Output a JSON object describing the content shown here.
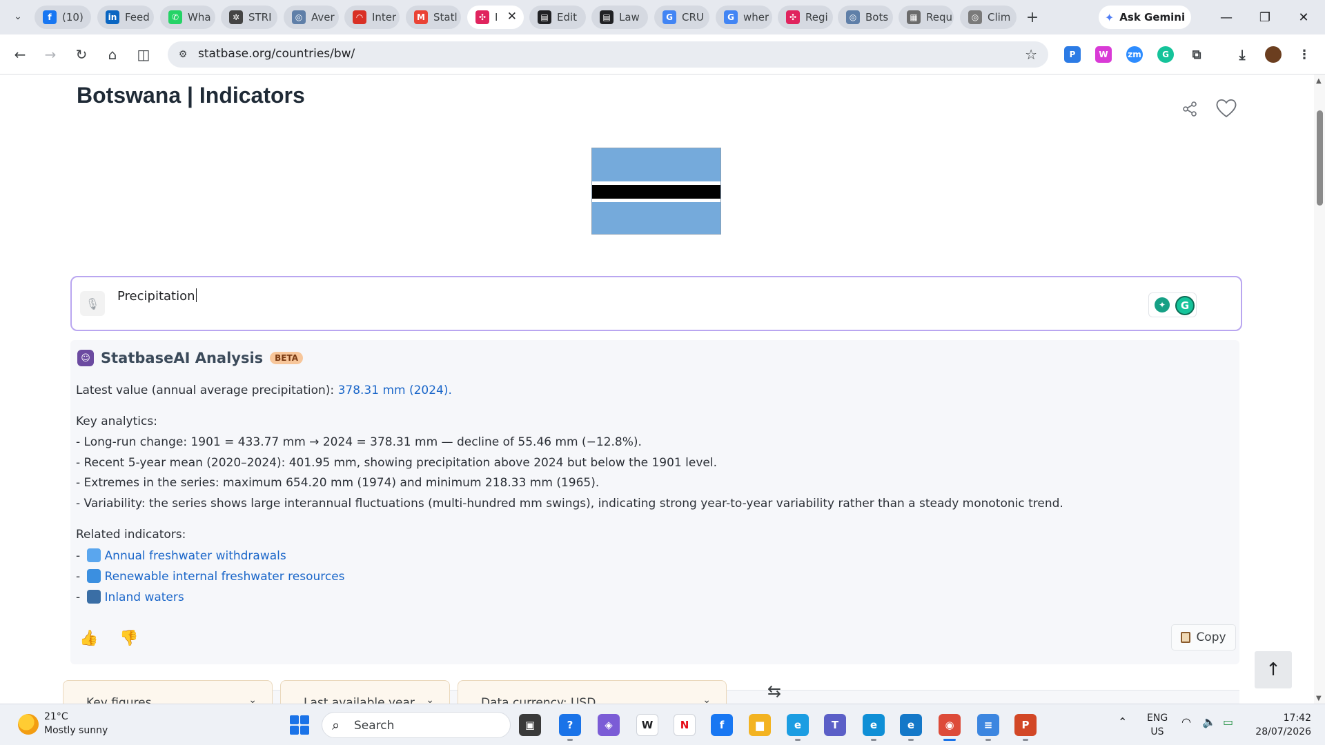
{
  "browser": {
    "tabs": [
      {
        "label": "(10)",
        "icon": "facebook-icon",
        "color": "#1877f2",
        "glyph": "f"
      },
      {
        "label": "Feed",
        "icon": "linkedin-icon",
        "color": "#0a66c2",
        "glyph": "in"
      },
      {
        "label": "Wha",
        "icon": "whatsapp-icon",
        "color": "#25d366",
        "glyph": "✆"
      },
      {
        "label": "STRI",
        "icon": "openai-icon",
        "color": "#444444",
        "glyph": "✲"
      },
      {
        "label": "Aver",
        "icon": "globe-icon",
        "color": "#5f7fa8",
        "glyph": "◎"
      },
      {
        "label": "Inter",
        "icon": "gauge-icon",
        "color": "#d93025",
        "glyph": "◠"
      },
      {
        "label": "Statl",
        "icon": "gmail-icon",
        "color": "#ea4335",
        "glyph": "M"
      },
      {
        "label": "I",
        "icon": "statbase-icon",
        "color": "#e0245e",
        "glyph": "✣",
        "active": true
      },
      {
        "label": "Edit",
        "icon": "terminal-icon",
        "color": "#202124",
        "glyph": "▤"
      },
      {
        "label": "Law",
        "icon": "terminal-icon",
        "color": "#202124",
        "glyph": "▤"
      },
      {
        "label": "CRU",
        "icon": "google-icon",
        "color": "#4285f4",
        "glyph": "G"
      },
      {
        "label": "wher",
        "icon": "google-icon",
        "color": "#4285f4",
        "glyph": "G"
      },
      {
        "label": "Regi",
        "icon": "statbase-icon",
        "color": "#e0245e",
        "glyph": "✣"
      },
      {
        "label": "Bots",
        "icon": "globe-icon",
        "color": "#5f7fa8",
        "glyph": "◎"
      },
      {
        "label": "Requ",
        "icon": "image-icon",
        "color": "#6b6b6b",
        "glyph": "▦"
      },
      {
        "label": "Clim",
        "icon": "globe-icon",
        "color": "#7a7a7a",
        "glyph": "◎"
      }
    ],
    "new_tab": "+",
    "gemini_label": "Ask Gemini",
    "url": "statbase.org/countries/bw/"
  },
  "page": {
    "title": "Botswana | Indicators",
    "flag_colors": {
      "blue": "#75aadb",
      "white": "#ffffff",
      "black": "#000000"
    },
    "search": {
      "value": "Precipitation"
    },
    "ai": {
      "title": "StatbaseAI Analysis",
      "badge": "BETA",
      "latest_prefix": "Latest value (annual average precipitation): ",
      "latest_value": "378.31 mm (2024).",
      "key_heading": "Key analytics:",
      "key_lines": [
        "- Long-run change: 1901 = 433.77 mm → 2024 = 378.31 mm — decline of 55.46 mm (−12.8%).",
        "- Recent 5-year mean (2020–2024): 401.95 mm, showing precipitation above 2024 but below the 1901 level.",
        "- Extremes in the series: maximum 654.20 mm (1974) and minimum 218.33 mm (1965).",
        "- Variability: the series shows large interannual fluctuations (multi-hundred mm swings), indicating strong year-to-year variability rather than a steady monotonic trend."
      ],
      "related_heading": "Related indicators:",
      "related": [
        {
          "label": "Annual freshwater withdrawals",
          "icon": "droplet-icon",
          "color": "#3b8fe0"
        },
        {
          "label": "Renewable internal freshwater resources",
          "icon": "wave-icon",
          "color": "#2f7fd0"
        },
        {
          "label": "Inland waters",
          "icon": "lake-icon",
          "color": "#3a6ea5"
        }
      ],
      "copy_label": "Copy"
    },
    "filters": [
      {
        "label": "Key figures"
      },
      {
        "label": "Last available year"
      },
      {
        "label": "Data currency: USD"
      }
    ]
  },
  "taskbar": {
    "weather_temp": "21°C",
    "weather_desc": "Mostly sunny",
    "search_label": "Search",
    "apps": [
      {
        "name": "taskview-icon",
        "color": "#3a3a3a",
        "glyph": "▣"
      },
      {
        "name": "help-icon",
        "color": "#1a73e8",
        "glyph": "?"
      },
      {
        "name": "m365-icon",
        "color": "#7b5cd6",
        "glyph": "◈"
      },
      {
        "name": "wikipedia-icon",
        "color": "#ffffff",
        "glyph": "W",
        "fg": "#202124"
      },
      {
        "name": "netflix-icon",
        "color": "#ffffff",
        "glyph": "N",
        "fg": "#e50914"
      },
      {
        "name": "facebook-icon",
        "color": "#1877f2",
        "glyph": "f"
      },
      {
        "name": "file-explorer-icon",
        "color": "#f3b321",
        "glyph": "▆"
      },
      {
        "name": "edge-icon",
        "color": "#1b9de2",
        "glyph": "e"
      },
      {
        "name": "teams-icon",
        "color": "#5b5fc7",
        "glyph": "T"
      },
      {
        "name": "edge-icon",
        "color": "#0f8fd6",
        "glyph": "e"
      },
      {
        "name": "edge-icon",
        "color": "#1478c8",
        "glyph": "e"
      },
      {
        "name": "chrome-icon",
        "color": "#dd4b39",
        "glyph": "◉"
      },
      {
        "name": "notepad-icon",
        "color": "#3c86e0",
        "glyph": "≡"
      },
      {
        "name": "powerpoint-icon",
        "color": "#d24726",
        "glyph": "P"
      }
    ],
    "lang": "ENG",
    "region": "US",
    "time": "17:42",
    "date": "28/07/2026"
  }
}
